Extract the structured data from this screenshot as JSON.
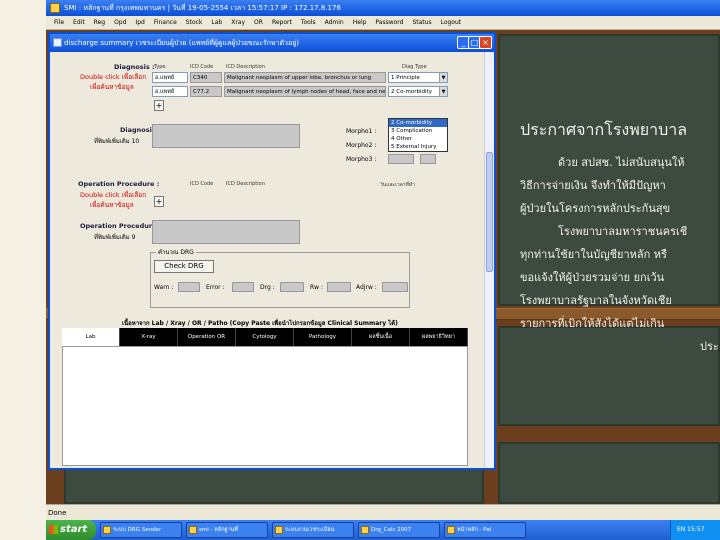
{
  "app": {
    "title": "SMI : หลักฐานที่ กรุงเทพมหานคร | วันที่ 19-05-2554 เวลา 15:57:17 IP : 172.17.8.176",
    "menu": [
      "File",
      "Edit",
      "Reg",
      "Opd",
      "Ipd",
      "Finance",
      "Stock",
      "Lab",
      "Xray",
      "OR",
      "Report",
      "Tools",
      "Admin",
      "Help",
      "Password",
      "Status",
      "Logout"
    ],
    "status": "Done"
  },
  "dialog": {
    "title": "discharge summary เวชระเบียนผู้ป่วย (แพทย์ที่ผู้ดูแลผู้ป่วยขณะรักษาตัวอยู่)",
    "diagnosis_label": "Diagnosis :",
    "diag_headers": [
      "Type",
      "ICD Code",
      "ICD Description",
      "Diag Type"
    ],
    "double_click_label": "Double click เพื่อเลือก",
    "double_click_sub": "เพื่อค้นหาข้อมูล",
    "diag_rows": [
      {
        "type": "อ.แพทย์",
        "code": "C340",
        "description": "Malignant neoplasm of upper lobe, bronchus or lung",
        "diag_type": "1 Principle"
      },
      {
        "type": "อ.แพทย์",
        "code": "C77.2",
        "description": "Malignant neoplasm of lymph nodes of head, face and neck",
        "diag_type": "2 Co-morbidity"
      }
    ],
    "diag_type_options": [
      "2 Co-morbidity",
      "3 Complication",
      "4 Other",
      "5 External Injury"
    ],
    "add_label": "+",
    "diagnosis_other_label": "Diagnosis",
    "diagnosis_other_sub": "ที่พิมพ์เพิ่มเติม 10",
    "morpho_labels": [
      "Morpho1 :",
      "Morpho2 :",
      "Morpho3 :"
    ],
    "op_label": "Operation Procedure :",
    "op_headers": [
      "ICD Code",
      "ICD Description",
      "วันและเวลาที่ทำ"
    ],
    "op_other_label": "Operation Procedure",
    "op_other_sub": "ที่พิมพ์เพิ่มเติม 9",
    "drg_group": "คำนวณ DRG",
    "check_drg": "Check DRG",
    "drg_fields": [
      "Warn :",
      "Error :",
      "Drg :",
      "Rw :",
      "Adjrw :"
    ],
    "lab_header": "เนื้อหาจาก Lab / Xray / OR / Patho (Copy Paste เพื่อนำไปกรอกข้อมูล Clinical Summary ได้)",
    "tabs": [
      "Lab",
      "X-ray",
      "Operation OR",
      "Cytology",
      "Pathology",
      "ผลชิ้นเนื้อ",
      "ผลพยาธิวิทยา"
    ]
  },
  "board": {
    "title": "ประกาศจากโรงพยาบาล",
    "lines": [
      "ด้วย สปสช. ไม่สนับสนุนให้",
      "วิธีการจ่ายเงิน จึงทำให้มีปัญหา",
      "ผู้ป่วยในโครงการหลักประกันสุข",
      "โรงพยาบาลมหาราชนครเชี",
      "ทุกท่านใช้ยาในบัญชียาหลัก หรื",
      "ขอแจ้งให้ผู้ป่วยรวมจ่าย ยกเว้น",
      "โรงพยาบาลรัฐบาลในจังหวัดเชีย",
      "รายการที่เบิกให้สังได้แต่ไม่เกิน",
      "ประ"
    ]
  },
  "taskbar": {
    "start": "start",
    "tasks": [
      "ระบบ DRG Sender",
      "smi - หลักฐานที่",
      "ระบบงานเวชระเบียน",
      "Drg_Calc 2007",
      "หน้าหลัก - Pal"
    ],
    "tray": "EN 15:57"
  }
}
